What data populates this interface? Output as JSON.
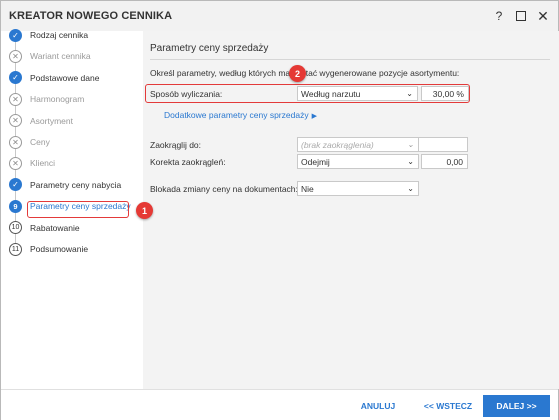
{
  "window": {
    "title": "KREATOR NOWEGO CENNIKA",
    "help_glyph": "?",
    "close_glyph": "✕"
  },
  "steps": [
    {
      "label": "Rodzaj cennika",
      "state": "done",
      "marker": "✓"
    },
    {
      "label": "Wariant cennika",
      "state": "skipped",
      "marker": "✕"
    },
    {
      "label": "Podstawowe dane",
      "state": "done",
      "marker": "✓"
    },
    {
      "label": "Harmonogram",
      "state": "skipped",
      "marker": "✕"
    },
    {
      "label": "Asortyment",
      "state": "skipped",
      "marker": "✕"
    },
    {
      "label": "Ceny",
      "state": "skipped",
      "marker": "✕"
    },
    {
      "label": "Klienci",
      "state": "skipped",
      "marker": "✕"
    },
    {
      "label": "Parametry ceny nabycia",
      "state": "done",
      "marker": "✓"
    },
    {
      "label": "Parametry ceny sprzedaży",
      "state": "current",
      "marker": "9"
    },
    {
      "label": "Rabatowanie",
      "state": "todo",
      "marker": "10"
    },
    {
      "label": "Podsumowanie",
      "state": "todo",
      "marker": "11"
    }
  ],
  "section": {
    "title": "Parametry ceny sprzedaży",
    "description": "Określ parametry, według których ma zostać wygenerowane pozycje asortymentu:"
  },
  "form": {
    "sposob": {
      "label": "Sposób wyliczania:",
      "value": "Według narzutu",
      "percent": "30,00 %"
    },
    "advanced_link": "Dodatkowe parametry ceny sprzedaży",
    "zaokraglij": {
      "label": "Zaokrąglij do:",
      "value": "(brak zaokrąglenia)"
    },
    "korekta": {
      "label": "Korekta zaokrągleń:",
      "value": "Odejmij",
      "amount": "0,00"
    },
    "blokada": {
      "label": "Blokada zmiany ceny na dokumentach:",
      "value": "Nie"
    }
  },
  "callouts": {
    "one": "1",
    "two": "2"
  },
  "footer": {
    "cancel": "ANULUJ",
    "back": "<< WSTECZ",
    "next": "DALEJ >>"
  },
  "colors": {
    "accent": "#2a78d0",
    "callout": "#e53935"
  }
}
